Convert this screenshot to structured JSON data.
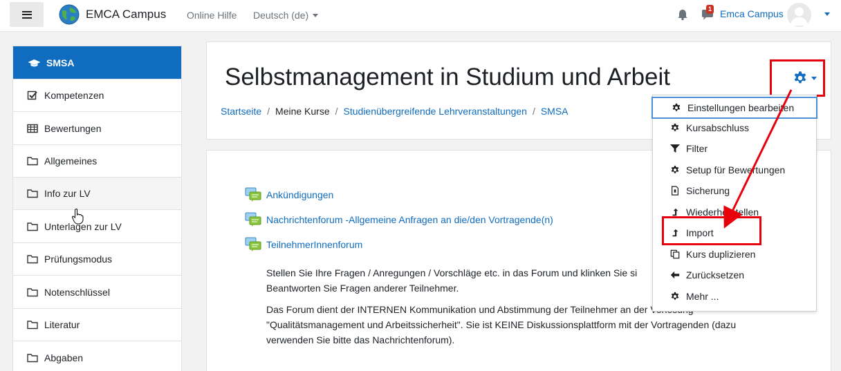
{
  "navbar": {
    "brand": "EMCA Campus",
    "help_link": "Online Hilfe",
    "language": "Deutsch (de)",
    "message_count": "1",
    "user_name": "Emca Campus"
  },
  "sidebar": {
    "items": [
      {
        "label": "SMSA",
        "icon": "graduation-cap-icon"
      },
      {
        "label": "Kompetenzen",
        "icon": "checkbox-icon"
      },
      {
        "label": "Bewertungen",
        "icon": "table-icon"
      },
      {
        "label": "Allgemeines",
        "icon": "folder-icon"
      },
      {
        "label": "Info zur LV",
        "icon": "folder-icon"
      },
      {
        "label": "Unterlagen zur LV",
        "icon": "folder-icon"
      },
      {
        "label": "Prüfungsmodus",
        "icon": "folder-icon"
      },
      {
        "label": "Notenschlüssel",
        "icon": "folder-icon"
      },
      {
        "label": "Literatur",
        "icon": "folder-icon"
      },
      {
        "label": "Abgaben",
        "icon": "folder-icon"
      }
    ]
  },
  "header": {
    "title": "Selbstmanagement in Studium und Arbeit",
    "breadcrumb": [
      "Startseite",
      "Meine Kurse",
      "Studienübergreifende Lehrveranstaltungen",
      "SMSA"
    ]
  },
  "content": {
    "forums": [
      "Ankündigungen",
      "Nachrichtenforum -Allgemeine Anfragen an die/den Vortragende(n)",
      "TeilnehmerInnenforum"
    ],
    "description": [
      "Stellen Sie Ihre Fragen / Anregungen / Vorschläge etc. in das Forum und klinken Sie si",
      "Beantworten Sie Fragen anderer Teilnehmer.",
      "Das Forum dient der INTERNEN Kommunikation und Abstimmung der Teilnehmer an der Vorlesung",
      "\"Qualitätsmanagement und Arbeitssicherheit\". Sie ist KEINE Diskussionsplattform mit der Vortragenden (dazu",
      "verwenden Sie bitte das Nachrichtenforum)."
    ]
  },
  "actions_menu": {
    "items": [
      {
        "label": "Einstellungen bearbeiten",
        "icon": "gear-icon"
      },
      {
        "label": "Kursabschluss",
        "icon": "gear-icon"
      },
      {
        "label": "Filter",
        "icon": "filter-icon"
      },
      {
        "label": "Setup für Bewertungen",
        "icon": "gear-icon"
      },
      {
        "label": "Sicherung",
        "icon": "backup-file-icon"
      },
      {
        "label": "Wiederherstellen",
        "icon": "level-up-icon"
      },
      {
        "label": "Import",
        "icon": "level-up-icon"
      },
      {
        "label": "Kurs duplizieren",
        "icon": "copy-icon"
      },
      {
        "label": "Zurücksetzen",
        "icon": "arrow-left-icon"
      },
      {
        "label": "Mehr ...",
        "icon": "gear-icon"
      }
    ]
  },
  "colors": {
    "accent": "#0f6cbf",
    "highlight": "#e8000b",
    "focus_outline": "#4a90d9",
    "forum_icon": "#7ac143"
  }
}
